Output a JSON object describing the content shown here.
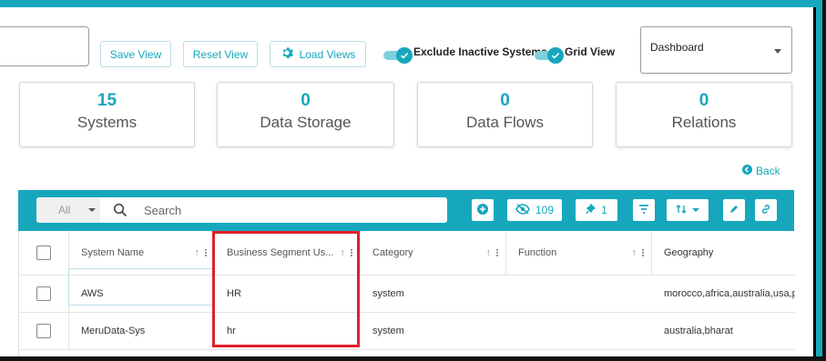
{
  "toolbar_top": {
    "save_view": "Save View",
    "reset_view": "Reset View",
    "load_views": "Load Views",
    "exclude_inactive_label": "Exclude Inactive Systems",
    "grid_view_label": "Grid View",
    "view_select": "Dashboard"
  },
  "stats": [
    {
      "value": "15",
      "label": "Systems"
    },
    {
      "value": "0",
      "label": "Data Storage"
    },
    {
      "value": "0",
      "label": "Data Flows"
    },
    {
      "value": "0",
      "label": "Relations"
    }
  ],
  "back_link": "Back",
  "grid_toolbar": {
    "filter_scope": "All",
    "search_placeholder": "Search",
    "hidden_count": "109",
    "pinned_count": "1"
  },
  "table": {
    "columns": [
      "System Name",
      "Business Segment Us...",
      "Category",
      "Function",
      "Geography"
    ],
    "rows": [
      {
        "system_name": "AWS",
        "business_segment": "HR",
        "category": "system",
        "function": "",
        "geography": "morocco,africa,australia,usa,p"
      },
      {
        "system_name": "MeruData-Sys",
        "business_segment": "hr",
        "category": "system",
        "function": "",
        "geography": "australia,bharat"
      }
    ]
  },
  "colors": {
    "accent": "#17a7bd",
    "highlight": "#e0202a"
  }
}
